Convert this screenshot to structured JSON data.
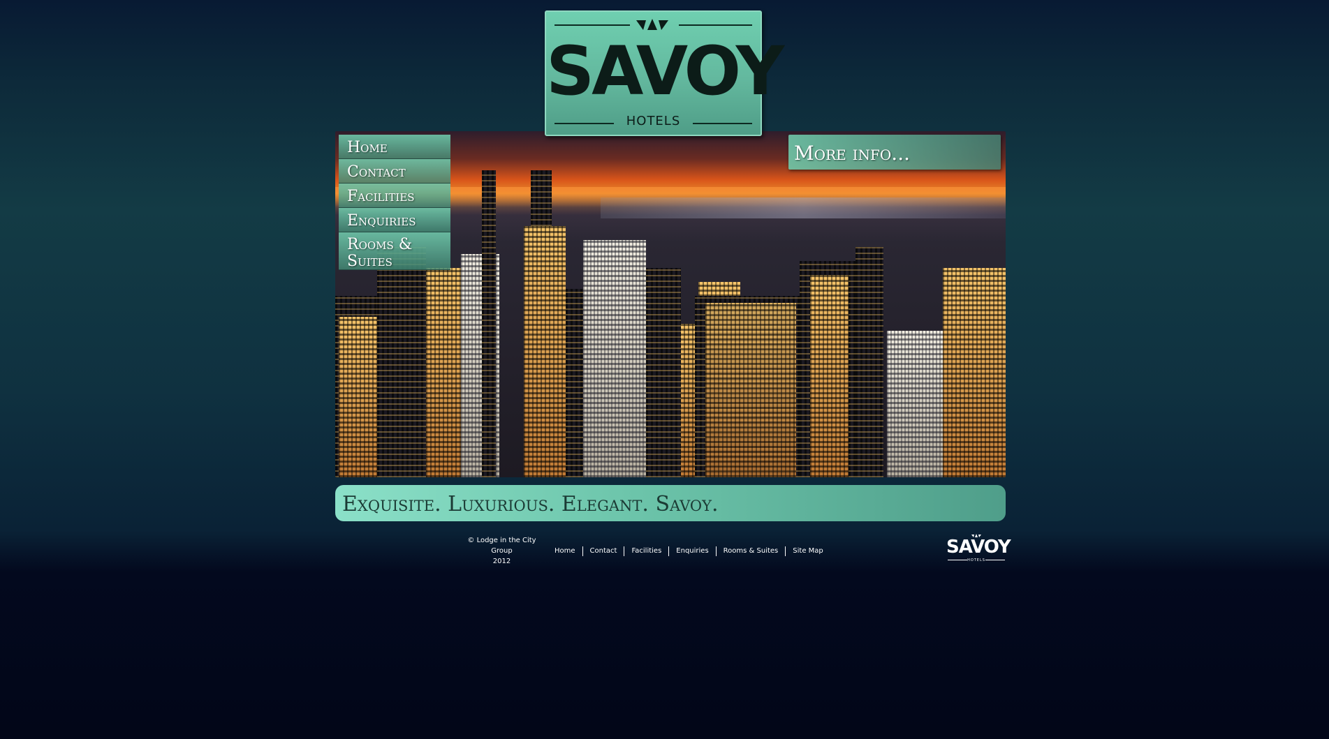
{
  "logo": {
    "wordmark": "SAVOY",
    "sub": "HOTELS"
  },
  "nav": {
    "items": [
      {
        "label": "Home"
      },
      {
        "label": "Contact"
      },
      {
        "label": "Facilities"
      },
      {
        "label": "Enquiries"
      },
      {
        "label": "Rooms & Suites"
      }
    ]
  },
  "more_info": {
    "label": "More info..."
  },
  "tagline": "Exquisite. Luxurious. Elegant. Savoy.",
  "footer": {
    "copyright_line1": "© Lodge in the City Group",
    "copyright_line2": "2012",
    "links": [
      "Home",
      "Contact",
      "Facilities",
      "Enquiries",
      "Rooms & Suites",
      "Site Map"
    ],
    "logo_word": "SAVOY",
    "logo_sub": "HOTELS"
  },
  "colors": {
    "accent": "#6fcfb0",
    "accent_dark": "#4f9d87",
    "background": "#0b2132"
  }
}
